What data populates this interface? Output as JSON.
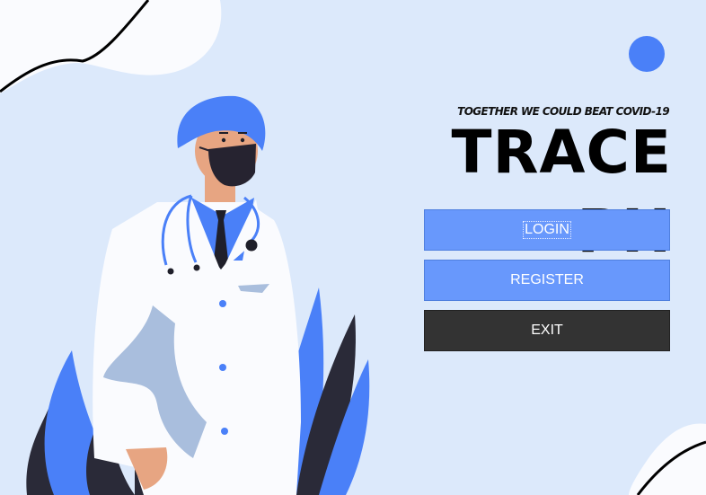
{
  "header": {
    "tagline": "TOGETHER WE COULD BEAT COVID-19",
    "title": "TRACE PH"
  },
  "buttons": {
    "login": "LOGIN",
    "register": "REGISTER",
    "exit": "EXIT"
  },
  "colors": {
    "background": "#dce9fb",
    "accent_blue": "#4a80f8",
    "button_blue": "#6898fc",
    "button_dark": "#333333"
  },
  "illustration": {
    "subject": "doctor-with-mask-and-stethoscope",
    "icons": [
      "doctor-illustration-icon",
      "plant-leaves-icon",
      "accent-dot-icon"
    ]
  }
}
